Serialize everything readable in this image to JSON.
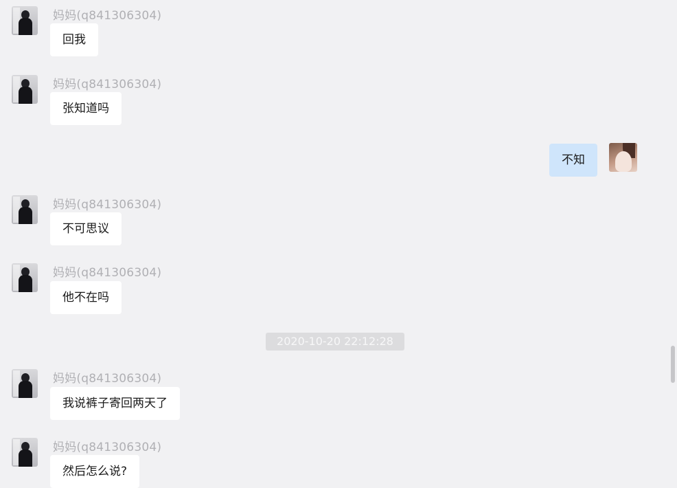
{
  "chat": {
    "messages": [
      {
        "sender": "妈妈(q841306304)",
        "text": "回我"
      },
      {
        "sender": "妈妈(q841306304)",
        "text": "张知道吗"
      },
      {
        "text": "不知"
      },
      {
        "sender": "妈妈(q841306304)",
        "text": "不可思议"
      },
      {
        "sender": "妈妈(q841306304)",
        "text": "他不在吗"
      },
      {
        "sender": "妈妈(q841306304)",
        "text": "我说裤子寄回两天了"
      },
      {
        "sender": "妈妈(q841306304)",
        "text": "然后怎么说?"
      }
    ],
    "timestamp": "2020-10-20 22:12:28"
  },
  "colors": {
    "background": "#f1f1f3",
    "incoming_bubble": "#ffffff",
    "outgoing_bubble": "#cfe5fb",
    "sender_text": "#b0b0b4",
    "timestamp_badge": "#dcdcde"
  },
  "icons": {
    "contact_avatar": "avatar-icon",
    "self_avatar": "avatar-icon"
  }
}
